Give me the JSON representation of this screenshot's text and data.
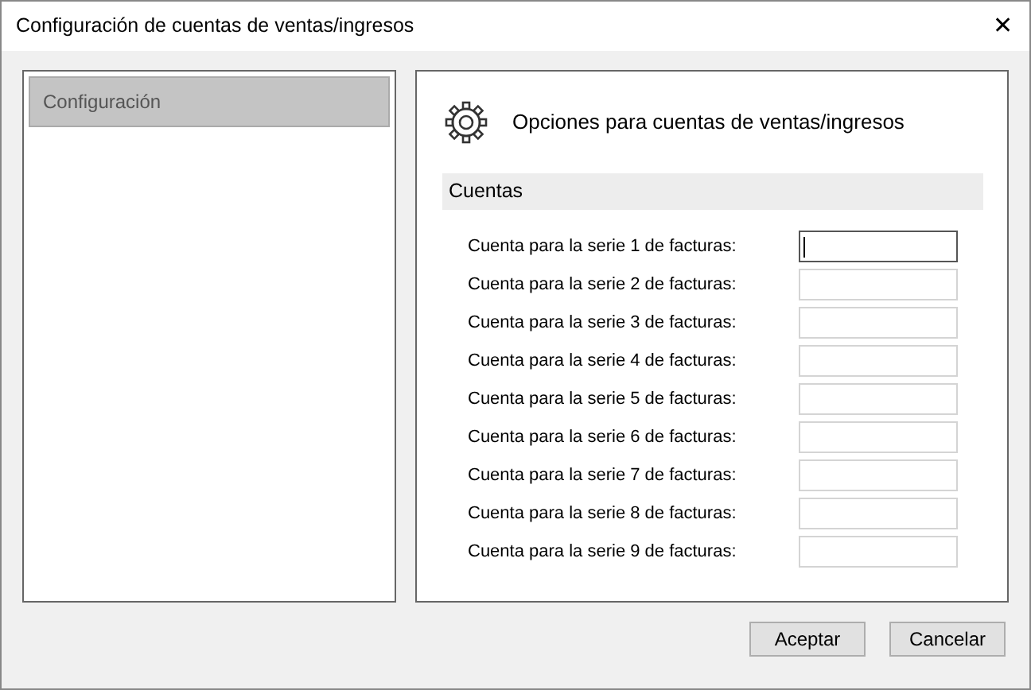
{
  "window": {
    "title": "Configuración de cuentas de ventas/ingresos",
    "close": "✕"
  },
  "sidebar": {
    "items": [
      {
        "label": "Configuración",
        "selected": true
      }
    ]
  },
  "panel": {
    "title": "Opciones para cuentas de ventas/ingresos",
    "section": "Cuentas",
    "fields": [
      {
        "label": "Cuenta para la serie 1 de facturas:",
        "focused": true
      },
      {
        "label": "Cuenta para la serie 2 de facturas:",
        "focused": false
      },
      {
        "label": "Cuenta para la serie 3 de facturas:",
        "focused": false
      },
      {
        "label": "Cuenta para la serie 4 de facturas:",
        "focused": false
      },
      {
        "label": "Cuenta para la serie 5 de facturas:",
        "focused": false
      },
      {
        "label": "Cuenta para la serie 6 de facturas:",
        "focused": false
      },
      {
        "label": "Cuenta para la serie 7 de facturas:",
        "focused": false
      },
      {
        "label": "Cuenta para la serie 8 de facturas:",
        "focused": false
      },
      {
        "label": "Cuenta para la serie 9 de facturas:",
        "focused": false
      }
    ]
  },
  "buttons": [
    "Aceptar",
    "Cancelar"
  ]
}
